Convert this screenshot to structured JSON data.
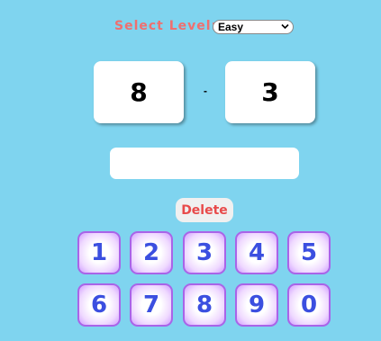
{
  "level": {
    "label": "Select Level:",
    "selected": "Easy"
  },
  "problem": {
    "left": "8",
    "operator": "-",
    "right": "3"
  },
  "answer": {
    "value": ""
  },
  "delete_label": "Delete",
  "keypad": {
    "row1": [
      "1",
      "2",
      "3",
      "4",
      "5"
    ],
    "row2": [
      "6",
      "7",
      "8",
      "9",
      "0"
    ]
  },
  "colors": {
    "background": "#7fd4ef",
    "level_label": "#ef6f6f",
    "delete_text": "#e84a4a",
    "key_digit": "#3b4fe0",
    "key_border": "#a964e8"
  },
  "icons": {
    "level_dropdown": "chevron-down-icon"
  }
}
